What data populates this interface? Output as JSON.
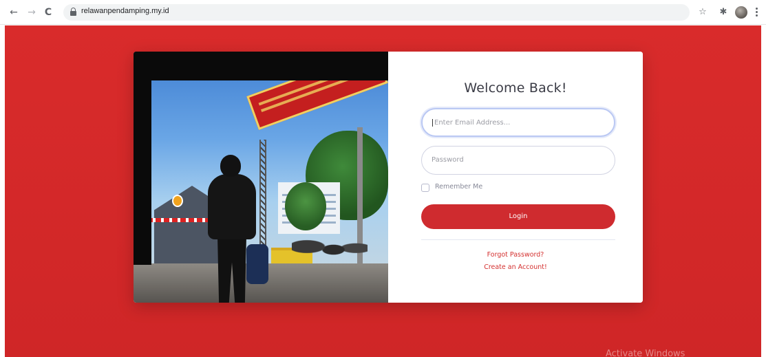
{
  "browser": {
    "url": "relawanpendamping.my.id",
    "back_icon": "←",
    "forward_icon": "→",
    "reload_icon": "C",
    "star_icon": "☆",
    "extensions_icon": "✱"
  },
  "login": {
    "title": "Welcome Back!",
    "email_placeholder": "Enter Email Address...",
    "password_placeholder": "Password",
    "remember_label": "Remember Me",
    "login_label": "Login",
    "forgot_label": "Forgot Password?",
    "create_label": "Create an Account!"
  },
  "watermark": "Activate Windows",
  "colors": {
    "brand_red": "#d92b2b",
    "button_red": "#cf2b2f",
    "link_red": "#d4302f"
  }
}
